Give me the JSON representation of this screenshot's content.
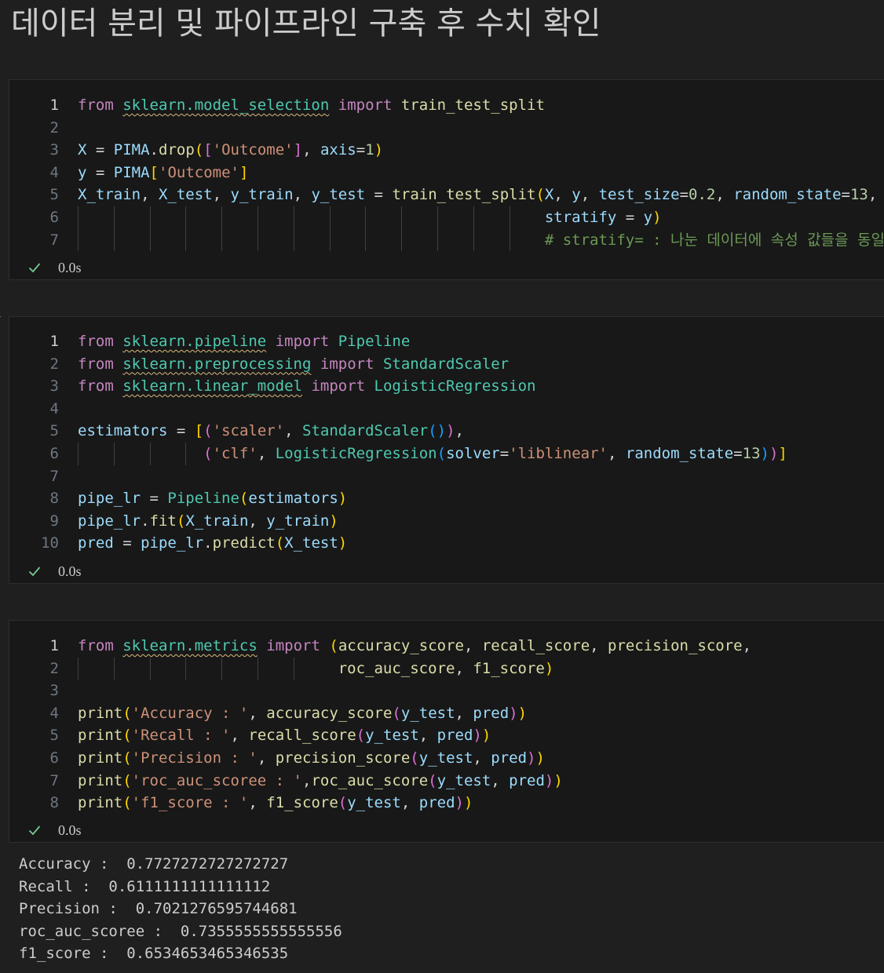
{
  "heading": "데이터 분리 및 파이프라인 구축 후 수치 확인",
  "cells": [
    {
      "exec_time": "0.0s",
      "lines": [
        {
          "n": "1",
          "tokens": [
            [
              "k",
              "from"
            ],
            [
              "p",
              " "
            ],
            [
              "m",
              "sklearn.model_selection"
            ],
            [
              "p",
              " "
            ],
            [
              "k",
              "import"
            ],
            [
              "p",
              " "
            ],
            [
              "f",
              "train_test_split"
            ]
          ]
        },
        {
          "n": "2",
          "tokens": []
        },
        {
          "n": "3",
          "tokens": [
            [
              "v",
              "X"
            ],
            [
              "p",
              " = "
            ],
            [
              "v",
              "PIMA"
            ],
            [
              "p",
              "."
            ],
            [
              "f",
              "drop"
            ],
            [
              "b1",
              "("
            ],
            [
              "b2",
              "["
            ],
            [
              "s",
              "'Outcome'"
            ],
            [
              "b2",
              "]"
            ],
            [
              "p",
              ", "
            ],
            [
              "v",
              "axis"
            ],
            [
              "p",
              "="
            ],
            [
              "n",
              "1"
            ],
            [
              "b1",
              ")"
            ]
          ]
        },
        {
          "n": "4",
          "tokens": [
            [
              "v",
              "y"
            ],
            [
              "p",
              " = "
            ],
            [
              "v",
              "PIMA"
            ],
            [
              "b1",
              "["
            ],
            [
              "s",
              "'Outcome'"
            ],
            [
              "b1",
              "]"
            ]
          ]
        },
        {
          "n": "5",
          "tokens": [
            [
              "v",
              "X_train"
            ],
            [
              "p",
              ", "
            ],
            [
              "v",
              "X_test"
            ],
            [
              "p",
              ", "
            ],
            [
              "v",
              "y_train"
            ],
            [
              "p",
              ", "
            ],
            [
              "v",
              "y_test"
            ],
            [
              "p",
              " = "
            ],
            [
              "f",
              "train_test_split"
            ],
            [
              "b1",
              "("
            ],
            [
              "v",
              "X"
            ],
            [
              "p",
              ", "
            ],
            [
              "v",
              "y"
            ],
            [
              "p",
              ", "
            ],
            [
              "v",
              "test_size"
            ],
            [
              "p",
              "="
            ],
            [
              "n",
              "0.2"
            ],
            [
              "p",
              ", "
            ],
            [
              "v",
              "random_state"
            ],
            [
              "p",
              "="
            ],
            [
              "n",
              "13"
            ],
            [
              "p",
              ","
            ]
          ]
        },
        {
          "n": "6",
          "tokens": [
            [
              "p",
              "                                                    "
            ],
            [
              "v",
              "stratify"
            ],
            [
              "p",
              " = "
            ],
            [
              "v",
              "y"
            ],
            [
              "b1",
              ")"
            ]
          ]
        },
        {
          "n": "7",
          "tokens": [
            [
              "p",
              "                                                    "
            ],
            [
              "cm",
              "# stratify= : 나눈 데이터에 속성 값들을 동일하게"
            ]
          ]
        }
      ]
    },
    {
      "exec_time": "0.0s",
      "lines": [
        {
          "n": "1",
          "tokens": [
            [
              "k",
              "from"
            ],
            [
              "p",
              " "
            ],
            [
              "m",
              "sklearn.pipeline"
            ],
            [
              "p",
              " "
            ],
            [
              "k",
              "import"
            ],
            [
              "p",
              " "
            ],
            [
              "c",
              "Pipeline"
            ]
          ]
        },
        {
          "n": "2",
          "tokens": [
            [
              "k",
              "from"
            ],
            [
              "p",
              " "
            ],
            [
              "m",
              "sklearn.preprocessing"
            ],
            [
              "p",
              " "
            ],
            [
              "k",
              "import"
            ],
            [
              "p",
              " "
            ],
            [
              "c",
              "StandardScaler"
            ]
          ]
        },
        {
          "n": "3",
          "tokens": [
            [
              "k",
              "from"
            ],
            [
              "p",
              " "
            ],
            [
              "m",
              "sklearn.linear_model"
            ],
            [
              "p",
              " "
            ],
            [
              "k",
              "import"
            ],
            [
              "p",
              " "
            ],
            [
              "c",
              "LogisticRegression"
            ]
          ]
        },
        {
          "n": "4",
          "tokens": []
        },
        {
          "n": "5",
          "tokens": [
            [
              "v",
              "estimators"
            ],
            [
              "p",
              " = "
            ],
            [
              "b1",
              "["
            ],
            [
              "b2",
              "("
            ],
            [
              "s",
              "'scaler'"
            ],
            [
              "p",
              ", "
            ],
            [
              "c",
              "StandardScaler"
            ],
            [
              "b3",
              "()"
            ],
            [
              "b2",
              ")"
            ],
            [
              "p",
              ","
            ]
          ]
        },
        {
          "n": "6",
          "tokens": [
            [
              "p",
              "              "
            ],
            [
              "b2",
              "("
            ],
            [
              "s",
              "'clf'"
            ],
            [
              "p",
              ", "
            ],
            [
              "c",
              "LogisticRegression"
            ],
            [
              "b3",
              "("
            ],
            [
              "v",
              "solver"
            ],
            [
              "p",
              "="
            ],
            [
              "s",
              "'liblinear'"
            ],
            [
              "p",
              ", "
            ],
            [
              "v",
              "random_state"
            ],
            [
              "p",
              "="
            ],
            [
              "n",
              "13"
            ],
            [
              "b3",
              ")"
            ],
            [
              "b2",
              ")"
            ],
            [
              "b1",
              "]"
            ]
          ]
        },
        {
          "n": "7",
          "tokens": []
        },
        {
          "n": "8",
          "tokens": [
            [
              "v",
              "pipe_lr"
            ],
            [
              "p",
              " = "
            ],
            [
              "c",
              "Pipeline"
            ],
            [
              "b1",
              "("
            ],
            [
              "v",
              "estimators"
            ],
            [
              "b1",
              ")"
            ]
          ]
        },
        {
          "n": "9",
          "tokens": [
            [
              "v",
              "pipe_lr"
            ],
            [
              "p",
              "."
            ],
            [
              "f",
              "fit"
            ],
            [
              "b1",
              "("
            ],
            [
              "v",
              "X_train"
            ],
            [
              "p",
              ", "
            ],
            [
              "v",
              "y_train"
            ],
            [
              "b1",
              ")"
            ]
          ]
        },
        {
          "n": "10",
          "tokens": [
            [
              "v",
              "pred"
            ],
            [
              "p",
              " = "
            ],
            [
              "v",
              "pipe_lr"
            ],
            [
              "p",
              "."
            ],
            [
              "f",
              "predict"
            ],
            [
              "b1",
              "("
            ],
            [
              "v",
              "X_test"
            ],
            [
              "b1",
              ")"
            ]
          ]
        }
      ]
    },
    {
      "exec_time": "0.0s",
      "lines": [
        {
          "n": "1",
          "tokens": [
            [
              "k",
              "from"
            ],
            [
              "p",
              " "
            ],
            [
              "m",
              "sklearn.metrics"
            ],
            [
              "p",
              " "
            ],
            [
              "k",
              "import"
            ],
            [
              "p",
              " "
            ],
            [
              "b1",
              "("
            ],
            [
              "f",
              "accuracy_score"
            ],
            [
              "p",
              ", "
            ],
            [
              "f",
              "recall_score"
            ],
            [
              "p",
              ", "
            ],
            [
              "f",
              "precision_score"
            ],
            [
              "p",
              ","
            ]
          ]
        },
        {
          "n": "2",
          "tokens": [
            [
              "p",
              "                             "
            ],
            [
              "f",
              "roc_auc_score"
            ],
            [
              "p",
              ", "
            ],
            [
              "f",
              "f1_score"
            ],
            [
              "b1",
              ")"
            ]
          ]
        },
        {
          "n": "3",
          "tokens": []
        },
        {
          "n": "4",
          "tokens": [
            [
              "f",
              "print"
            ],
            [
              "b1",
              "("
            ],
            [
              "s",
              "'Accuracy : '"
            ],
            [
              "p",
              ", "
            ],
            [
              "f",
              "accuracy_score"
            ],
            [
              "b2",
              "("
            ],
            [
              "v",
              "y_test"
            ],
            [
              "p",
              ", "
            ],
            [
              "v",
              "pred"
            ],
            [
              "b2",
              ")"
            ],
            [
              "b1",
              ")"
            ]
          ]
        },
        {
          "n": "5",
          "tokens": [
            [
              "f",
              "print"
            ],
            [
              "b1",
              "("
            ],
            [
              "s",
              "'Recall : '"
            ],
            [
              "p",
              ", "
            ],
            [
              "f",
              "recall_score"
            ],
            [
              "b2",
              "("
            ],
            [
              "v",
              "y_test"
            ],
            [
              "p",
              ", "
            ],
            [
              "v",
              "pred"
            ],
            [
              "b2",
              ")"
            ],
            [
              "b1",
              ")"
            ]
          ]
        },
        {
          "n": "6",
          "tokens": [
            [
              "f",
              "print"
            ],
            [
              "b1",
              "("
            ],
            [
              "s",
              "'Precision : '"
            ],
            [
              "p",
              ", "
            ],
            [
              "f",
              "precision_score"
            ],
            [
              "b2",
              "("
            ],
            [
              "v",
              "y_test"
            ],
            [
              "p",
              ", "
            ],
            [
              "v",
              "pred"
            ],
            [
              "b2",
              ")"
            ],
            [
              "b1",
              ")"
            ]
          ]
        },
        {
          "n": "7",
          "tokens": [
            [
              "f",
              "print"
            ],
            [
              "b1",
              "("
            ],
            [
              "s",
              "'roc_auc_scoree : '"
            ],
            [
              "p",
              ","
            ],
            [
              "f",
              "roc_auc_score"
            ],
            [
              "b2",
              "("
            ],
            [
              "v",
              "y_test"
            ],
            [
              "p",
              ", "
            ],
            [
              "v",
              "pred"
            ],
            [
              "b2",
              ")"
            ],
            [
              "b1",
              ")"
            ]
          ]
        },
        {
          "n": "8",
          "tokens": [
            [
              "f",
              "print"
            ],
            [
              "b1",
              "("
            ],
            [
              "s",
              "'f1_score : '"
            ],
            [
              "p",
              ", "
            ],
            [
              "f",
              "f1_score"
            ],
            [
              "b2",
              "("
            ],
            [
              "v",
              "y_test"
            ],
            [
              "p",
              ", "
            ],
            [
              "v",
              "pred"
            ],
            [
              "b2",
              ")"
            ],
            [
              "b1",
              ")"
            ]
          ]
        }
      ],
      "output": [
        "Accuracy :  0.7727272727272727",
        "Recall :  0.6111111111111112",
        "Precision :  0.7021276595744681",
        "roc_auc_scoree :  0.7355555555555556",
        "f1_score :  0.6534653465346535"
      ]
    }
  ],
  "colors": {
    "background": "#1f1f1f",
    "cell_background": "#181818",
    "check_green": "#73c991"
  }
}
